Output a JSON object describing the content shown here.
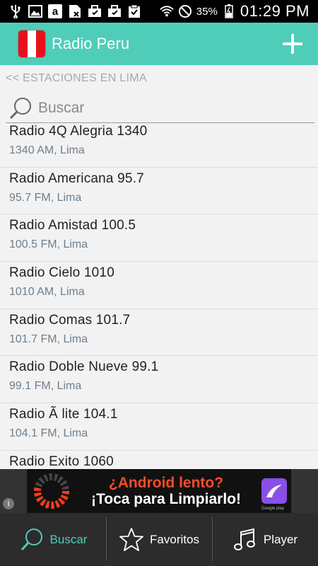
{
  "status_bar": {
    "battery_percent": "35%",
    "time": "01:29 PM",
    "icons": [
      "usb-icon",
      "image-icon",
      "amazon-icon",
      "note-icon",
      "briefcase-icon",
      "briefcase-icon",
      "clipboard-check-icon",
      "wifi-icon",
      "no-entry-icon",
      "battery-icon"
    ]
  },
  "app_bar": {
    "title": "Radio Peru",
    "flag_colors": [
      "#e8101c",
      "#ffffff",
      "#e8101c"
    ],
    "accent_color": "#4fcdb9"
  },
  "breadcrumb": "<< ESTACIONES EN LIMA",
  "search": {
    "placeholder": "Buscar",
    "value": ""
  },
  "stations": [
    {
      "name": "Radio 4Q Alegria 1340",
      "detail": "1340 AM, Lima"
    },
    {
      "name": "Radio Americana 95.7",
      "detail": "95.7 FM, Lima"
    },
    {
      "name": "Radio Amistad 100.5",
      "detail": "100.5 FM, Lima"
    },
    {
      "name": "Radio Cielo 1010",
      "detail": "1010 AM, Lima"
    },
    {
      "name": "Radio Comas 101.7",
      "detail": "101.7 FM, Lima"
    },
    {
      "name": "Radio Doble Nueve 99.1",
      "detail": "99.1 FM, Lima"
    },
    {
      "name": "Radio Ã lite 104.1",
      "detail": "104.1 FM, Lima"
    },
    {
      "name": "Radio Exito 1060",
      "detail": ""
    }
  ],
  "ad": {
    "line1": "¿Android lento?",
    "line2": "¡Toca para Limpiarlo!",
    "badge": "Google play",
    "info": "i"
  },
  "bottom_nav": [
    {
      "label": "Buscar",
      "icon": "search-icon",
      "active": true
    },
    {
      "label": "Favoritos",
      "icon": "star-icon",
      "active": false
    },
    {
      "label": "Player",
      "icon": "music-note-icon",
      "active": false
    }
  ]
}
